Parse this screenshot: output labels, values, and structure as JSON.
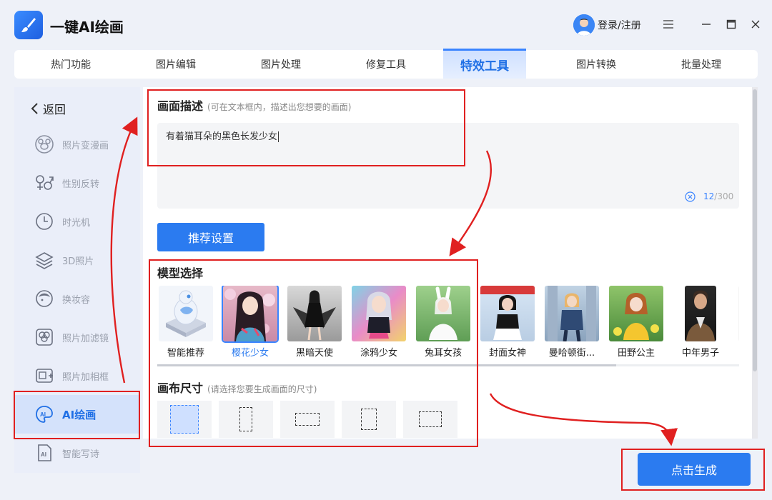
{
  "app": {
    "title": "一键AI绘画",
    "login_label": "登录/注册"
  },
  "tabs": [
    {
      "label": "热门功能"
    },
    {
      "label": "图片编辑"
    },
    {
      "label": "图片处理"
    },
    {
      "label": "修复工具"
    },
    {
      "label": "特效工具",
      "active": true
    },
    {
      "label": "图片转换"
    },
    {
      "label": "批量处理"
    }
  ],
  "sidebar": {
    "back_label": "返回",
    "items": [
      {
        "label": "照片变漫画",
        "icon": "bear-face-icon"
      },
      {
        "label": "性别反转",
        "icon": "gender-icon"
      },
      {
        "label": "时光机",
        "icon": "clock-icon"
      },
      {
        "label": "3D照片",
        "icon": "layers-icon"
      },
      {
        "label": "换妆容",
        "icon": "makeup-face-icon"
      },
      {
        "label": "照片加滤镜",
        "icon": "filter-icon"
      },
      {
        "label": "照片加相框",
        "icon": "frame-icon"
      },
      {
        "label": "AI绘画",
        "icon": "ai-paint-icon",
        "active": true
      },
      {
        "label": "智能写诗",
        "icon": "ai-document-icon"
      }
    ]
  },
  "description": {
    "title": "画面描述",
    "hint": "(可在文本框内，描述出您想要的画面)",
    "value": "有着猫耳朵的黑色长发少女",
    "count_current": "12",
    "count_max": "/300"
  },
  "recommend_label": "推荐设置",
  "model_section": {
    "title": "模型选择",
    "models": [
      {
        "label": "智能推荐"
      },
      {
        "label": "樱花少女",
        "selected": true
      },
      {
        "label": "黑暗天使"
      },
      {
        "label": "涂鸦少女"
      },
      {
        "label": "兔耳女孩"
      },
      {
        "label": "封面女神"
      },
      {
        "label": "曼哈顿街..."
      },
      {
        "label": "田野公主"
      },
      {
        "label": "中年男子"
      }
    ]
  },
  "canvas_section": {
    "title": "画布尺寸",
    "hint": "(请选择您要生成画面的尺寸)"
  },
  "generate_label": "点击生成",
  "colors": {
    "accent": "#2b7bf0",
    "annotation": "#e02020"
  }
}
